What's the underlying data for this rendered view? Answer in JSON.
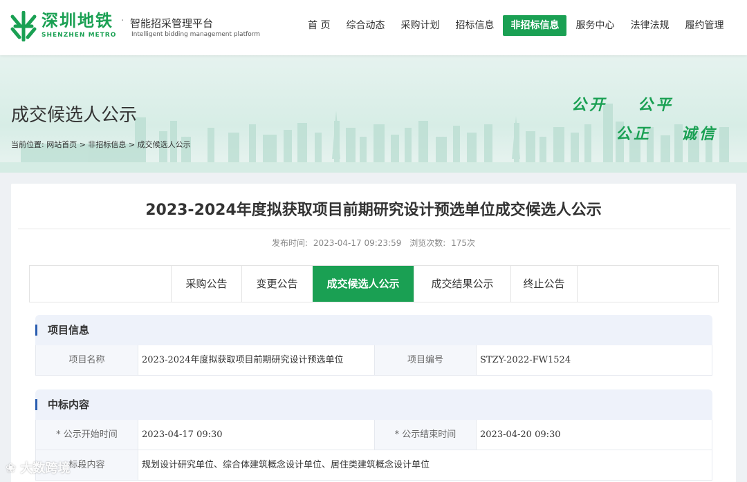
{
  "header": {
    "logo_cn": "深圳地铁",
    "logo_en": "SHENZHEN METRO",
    "platform_cn": "智能招采管理平台",
    "platform_en": "Intelligent bidding management platform",
    "nav": [
      "首 页",
      "综合动态",
      "采购计划",
      "招标信息",
      "非招标信息",
      "服务中心",
      "法律法规",
      "履约管理"
    ],
    "active_nav": 4
  },
  "banner": {
    "title": "成交候选人公示",
    "breadcrumb": "当前位置:  网站首页 > 非招标信息 > 成交候选人公示",
    "slogans": [
      "公开",
      "公平",
      "公正",
      "诚信"
    ]
  },
  "article": {
    "title": "2023-2024年度拟获取项目前期研究设计预选单位成交候选人公示",
    "publish_label": "发布时间:",
    "publish_time": "2023-04-17 09:23:59",
    "views_label": "浏览次数:",
    "views": "175次"
  },
  "tabs": [
    "采购公告",
    "变更公告",
    "成交候选人公示",
    "成交结果公示",
    "终止公告"
  ],
  "active_tab": 2,
  "project_info": {
    "heading": "项目信息",
    "name_label": "项目名称",
    "name_value": "2023-2024年度拟获取项目前期研究设计预选单位",
    "code_label": "项目编号",
    "code_value": "STZY-2022-FW1524"
  },
  "award": {
    "heading": "中标内容",
    "start_label": "* 公示开始时间",
    "start_value": "2023-04-17 09:30",
    "end_label": "* 公示结束时间",
    "end_value": "2023-04-20 09:30",
    "content_label": "标段内容",
    "content_value": "规划设计研究单位、综合体建筑概念设计单位、居住类建筑概念设计单位"
  },
  "watermark": "大数跨境",
  "colors": {
    "brand": "#1aa053",
    "accent_bar": "#2a5db0"
  }
}
